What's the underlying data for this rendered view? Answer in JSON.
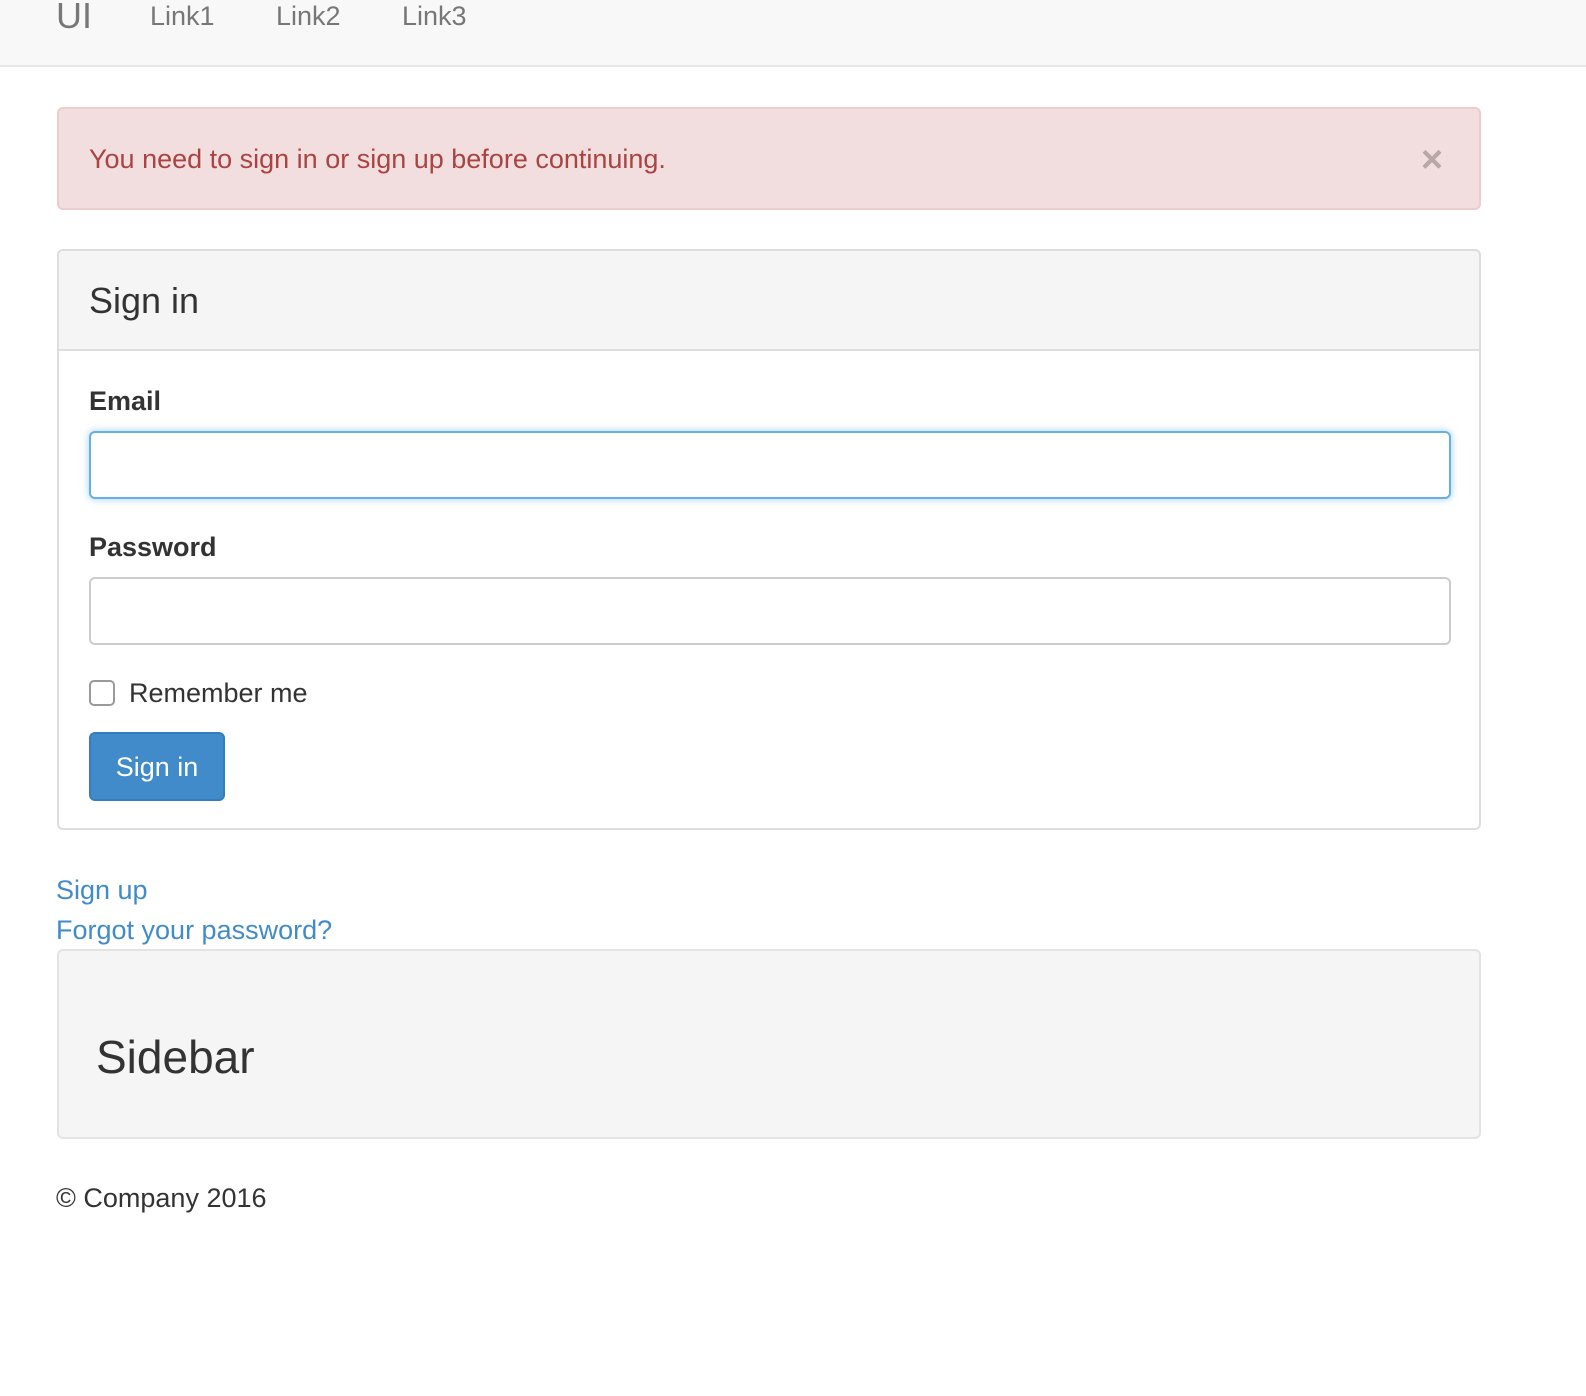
{
  "navbar": {
    "brand": "UI",
    "links": [
      "Link1",
      "Link2",
      "Link3"
    ]
  },
  "alert": {
    "message": "You need to sign in or sign up before continuing.",
    "close_symbol": "×",
    "background_color": "#f2dede",
    "text_color": "#a94442"
  },
  "signin_panel": {
    "title": "Sign in",
    "email_label": "Email",
    "email_value": "",
    "password_label": "Password",
    "password_value": "",
    "remember_label": "Remember me",
    "remember_checked": false,
    "submit_label": "Sign in",
    "button_color": "#428bca"
  },
  "links": {
    "sign_up": "Sign up",
    "forgot_password": "Forgot your password?",
    "link_color": "#428bca"
  },
  "sidebar": {
    "title": "Sidebar"
  },
  "footer": {
    "text": "© Company 2016"
  }
}
